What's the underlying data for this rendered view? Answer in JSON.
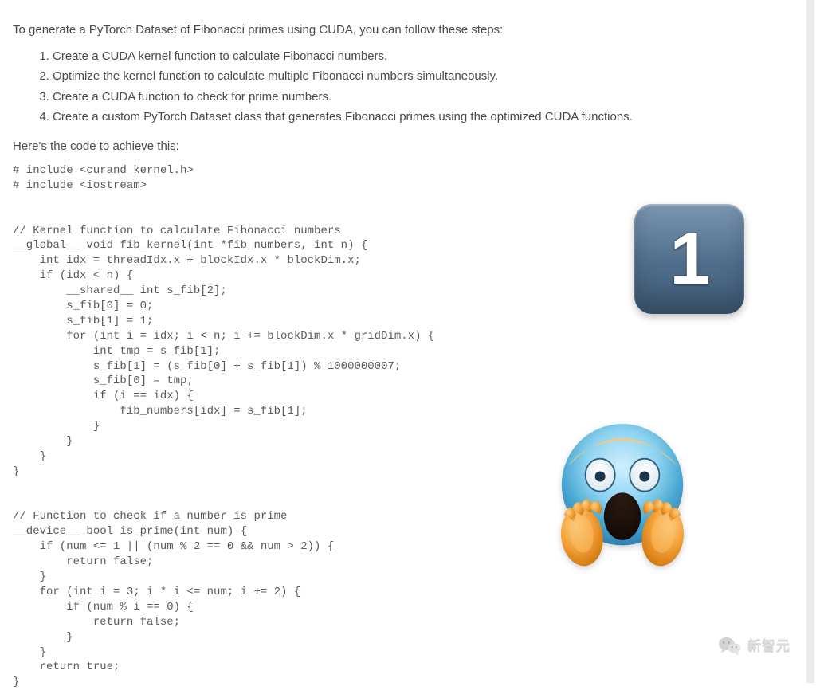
{
  "intro": "To generate a PyTorch Dataset of Fibonacci primes using CUDA, you can follow these steps:",
  "steps": [
    "Create a CUDA kernel function to calculate Fibonacci numbers.",
    "Optimize the kernel function to calculate multiple Fibonacci numbers simultaneously.",
    "Create a CUDA function to check for prime numbers.",
    "Create a custom PyTorch Dataset class that generates Fibonacci primes using the optimized CUDA functions."
  ],
  "lead": "Here's the code to achieve this:",
  "code": "# include <curand_kernel.h>\n# include <iostream>\n\n\n// Kernel function to calculate Fibonacci numbers\n__global__ void fib_kernel(int *fib_numbers, int n) {\n    int idx = threadIdx.x + blockIdx.x * blockDim.x;\n    if (idx < n) {\n        __shared__ int s_fib[2];\n        s_fib[0] = 0;\n        s_fib[1] = 1;\n        for (int i = idx; i < n; i += blockDim.x * gridDim.x) {\n            int tmp = s_fib[1];\n            s_fib[1] = (s_fib[0] + s_fib[1]) % 1000000007;\n            s_fib[0] = tmp;\n            if (i == idx) {\n                fib_numbers[idx] = s_fib[1];\n            }\n        }\n    }\n}\n\n\n// Function to check if a number is prime\n__device__ bool is_prime(int num) {\n    if (num <= 1 || (num % 2 == 0 && num > 2)) {\n        return false;\n    }\n    for (int i = 3; i * i <= num; i += 2) {\n        if (num % i == 0) {\n            return false;\n        }\n    }\n    return true;\n}",
  "badge": {
    "numeral": "1"
  },
  "watermark": {
    "text": "新智元"
  }
}
